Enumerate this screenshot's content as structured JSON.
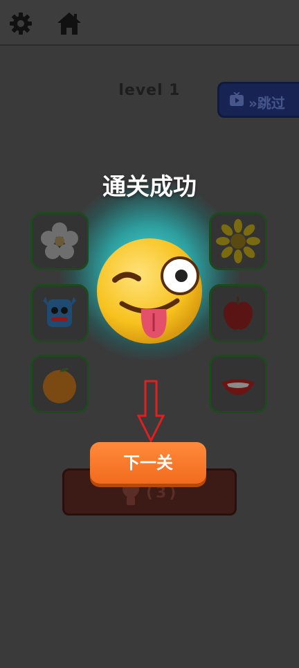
{
  "header": {
    "settings_icon": "gear-icon",
    "home_icon": "home-icon"
  },
  "level_label": "level 1",
  "skip_button": {
    "label": "»跳过",
    "icon": "tv-icon"
  },
  "result_title": "通关成功",
  "tiles_left": [
    "flower-icon",
    "blue-monster-icon",
    "orange-icon"
  ],
  "tiles_right": [
    "sunflower-icon",
    "apple-icon",
    "lips-icon"
  ],
  "center_emoji": "winking-tongue-emoji",
  "next_button": {
    "label": "下一关"
  },
  "hint_button": {
    "count": "(3)",
    "icon": "lightbulb-icon"
  },
  "colors": {
    "glow": "#46e6e6",
    "next_button": "#f47a2a",
    "skip_button": "#172453",
    "hint_button": "#3c1a15"
  }
}
